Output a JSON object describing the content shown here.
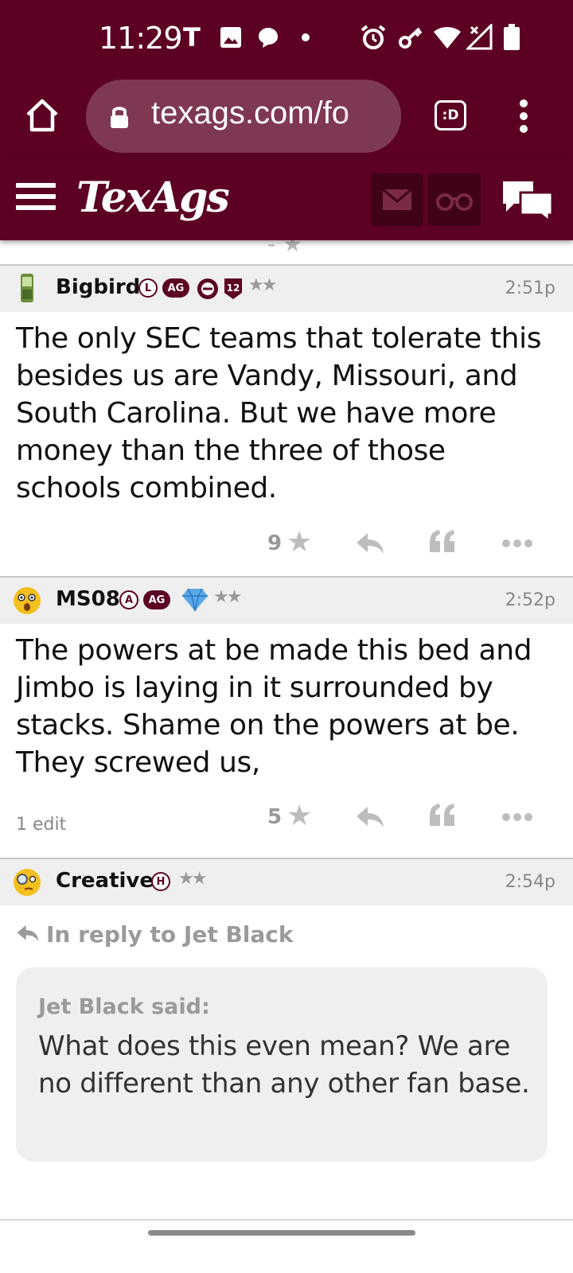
{
  "status_bar": {
    "time": "11:29",
    "icons": [
      "t-mobile-icon",
      "image-icon",
      "message-icon",
      "dot-icon",
      "alarm-icon",
      "key-icon",
      "wifi-icon",
      "signal-icon",
      "battery-icon"
    ]
  },
  "browser": {
    "url": "texags.com/fo",
    "tab_label": ":D"
  },
  "site": {
    "logo": "TexAgs",
    "accent": "#5c0124"
  },
  "posts": [
    {
      "username": "Bigbird",
      "badges": [
        "L",
        "AG"
      ],
      "time": "2:51p",
      "body": "The only SEC teams that tolerate this besides us are Vandy, Missouri, and South Carolina. But we have more money than the three of those schools combined.",
      "stars": "★★",
      "star_count": "9"
    },
    {
      "username": "MS08",
      "badges": [
        "A",
        "AG"
      ],
      "time": "2:52p",
      "body": "The powers at be made this bed and Jimbo is laying in it surrounded by stacks. Shame on the powers at be. They screwed us,",
      "stars": "★★",
      "star_count": "5",
      "edit_note": "1 edit"
    },
    {
      "username": "Creative",
      "badges": [
        "H"
      ],
      "time": "2:54p",
      "stars": "★★",
      "reply_to": "In reply to Jet Black",
      "quote_author": "Jet Black said:",
      "quote_text": "What does this even mean? We are no different than any other fan base."
    }
  ]
}
